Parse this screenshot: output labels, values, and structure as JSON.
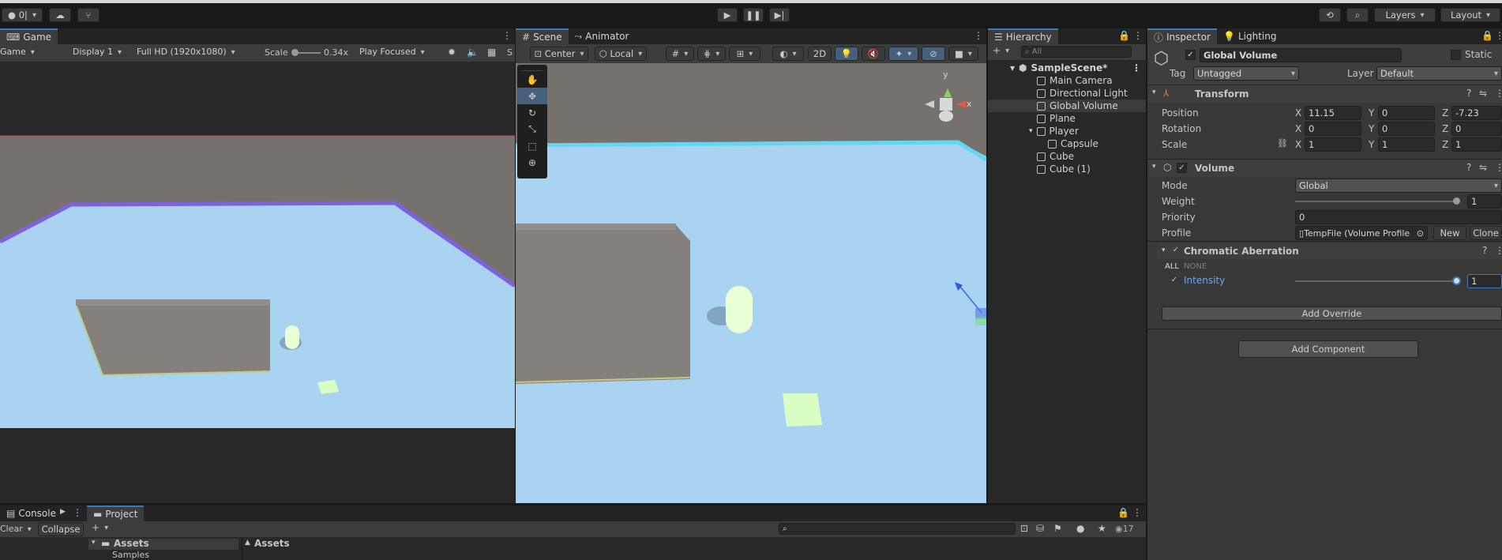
{
  "toolbar": {
    "account_label": "0|",
    "play_icon": "play-icon",
    "pause_icon": "pause-icon",
    "step_icon": "step-icon",
    "layers_label": "Layers",
    "layout_label": "Layout"
  },
  "game": {
    "tab_label": "Game",
    "view_select": "Game",
    "display_select": "Display 1",
    "resolution_select": "Full HD (1920x1080)",
    "scale_label": "Scale",
    "scale_value": "0.34x",
    "play_mode_select": "Play Focused"
  },
  "scene": {
    "tab_label": "Scene",
    "animator_tab_label": "Animator",
    "pivot_select": "Center",
    "space_select": "Local",
    "mode_2d_label": "2D",
    "gizmo_axis_y": "y",
    "gizmo_axis_x": "x"
  },
  "hierarchy": {
    "tab_label": "Hierarchy",
    "search_placeholder": "All",
    "scene_name": "SampleScene*",
    "items": [
      {
        "label": "Main Camera"
      },
      {
        "label": "Directional Light"
      },
      {
        "label": "Global Volume"
      },
      {
        "label": "Plane"
      },
      {
        "label": "Player"
      },
      {
        "label": "Capsule"
      },
      {
        "label": "Cube"
      },
      {
        "label": "Cube (1)"
      }
    ]
  },
  "inspector": {
    "tab_label": "Inspector",
    "lighting_tab_label": "Lighting",
    "object_name": "Global Volume",
    "static_label": "Static",
    "tag_label": "Tag",
    "tag_value": "Untagged",
    "layer_label": "Layer",
    "layer_value": "Default",
    "transform": {
      "title": "Transform",
      "position_label": "Position",
      "rotation_label": "Rotation",
      "scale_label": "Scale",
      "x": "X",
      "y": "Y",
      "z": "Z",
      "position": {
        "x": "11.15",
        "y": "0",
        "z": "-7.23"
      },
      "rotation": {
        "x": "0",
        "y": "0",
        "z": "0"
      },
      "scale": {
        "x": "1",
        "y": "1",
        "z": "1"
      }
    },
    "volume": {
      "title": "Volume",
      "mode_label": "Mode",
      "mode_value": "Global",
      "weight_label": "Weight",
      "weight_value": "1",
      "priority_label": "Priority",
      "priority_value": "0",
      "profile_label": "Profile",
      "profile_value": "TempFile (Volume Profile",
      "new_label": "New",
      "clone_label": "Clone"
    },
    "chromatic": {
      "title": "Chromatic Aberration",
      "all_label": "ALL",
      "none_label": "NONE",
      "intensity_label": "Intensity",
      "intensity_value": "1"
    },
    "add_override_label": "Add Override",
    "add_component_label": "Add Component"
  },
  "console": {
    "tab_label": "Console",
    "clear_label": "Clear",
    "collapse_label": "Collapse"
  },
  "project": {
    "tab_label": "Project",
    "count_label": "17",
    "tree_root": "Assets",
    "tree_child": "Samples",
    "breadcrumb": "Assets"
  },
  "colors": {
    "accent": "#3a79bb",
    "sky_floor": "#a9d3f0",
    "wall": "#77716e",
    "selected_row": "#3b3b3b"
  }
}
